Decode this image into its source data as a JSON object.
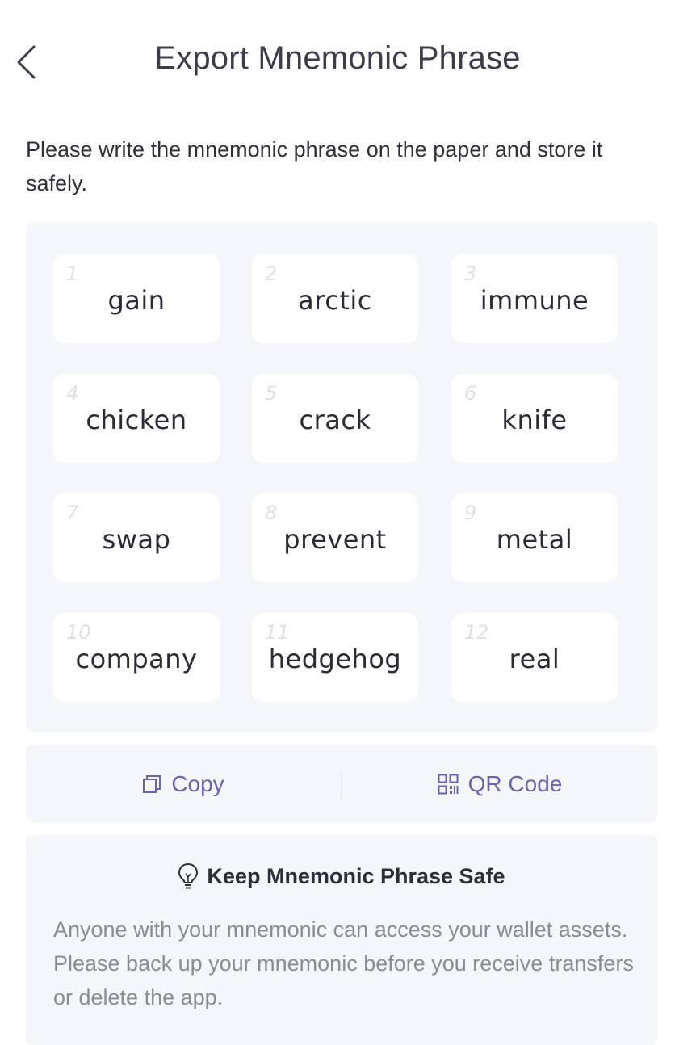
{
  "header": {
    "title": "Export Mnemonic Phrase",
    "back_icon": "chevron-left-icon"
  },
  "instruction": "Please write the mnemonic phrase on the paper and store it safely.",
  "mnemonic": {
    "words": [
      {
        "index": "1",
        "word": "gain"
      },
      {
        "index": "2",
        "word": "arctic"
      },
      {
        "index": "3",
        "word": "immune"
      },
      {
        "index": "4",
        "word": "chicken"
      },
      {
        "index": "5",
        "word": "crack"
      },
      {
        "index": "6",
        "word": "knife"
      },
      {
        "index": "7",
        "word": "swap"
      },
      {
        "index": "8",
        "word": "prevent"
      },
      {
        "index": "9",
        "word": "metal"
      },
      {
        "index": "10",
        "word": "company"
      },
      {
        "index": "11",
        "word": "hedgehog"
      },
      {
        "index": "12",
        "word": "real"
      }
    ]
  },
  "actions": {
    "copy_label": "Copy",
    "copy_icon": "copy-icon",
    "qr_label": "QR Code",
    "qr_icon": "qr-code-icon"
  },
  "tips": {
    "icon": "lightbulb-icon",
    "heading": "Keep Mnemonic Phrase Safe",
    "body": "Anyone with your mnemonic can access your wallet assets. Please back up your mnemonic before you receive transfers or delete the app."
  },
  "colors": {
    "accent": "#6a63b5",
    "panel_background": "#f5f6fa",
    "card_background": "#ffffff",
    "muted_text": "#8a8b96"
  }
}
